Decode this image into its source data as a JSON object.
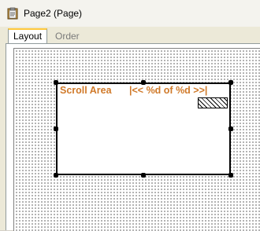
{
  "window": {
    "title": "Page2 (Page)",
    "icon": "clipboard-page-icon"
  },
  "tabs": [
    {
      "label": "Layout",
      "active": true
    },
    {
      "label": "Order",
      "active": false
    }
  ],
  "scroll_area": {
    "label": "Scroll Area",
    "nav_text": "|<< %d of %d >>|",
    "label_color": "#d07a2a",
    "selected": true
  },
  "colors": {
    "tab_accent": "#ffc83c",
    "canvas_grid": "#000000"
  }
}
